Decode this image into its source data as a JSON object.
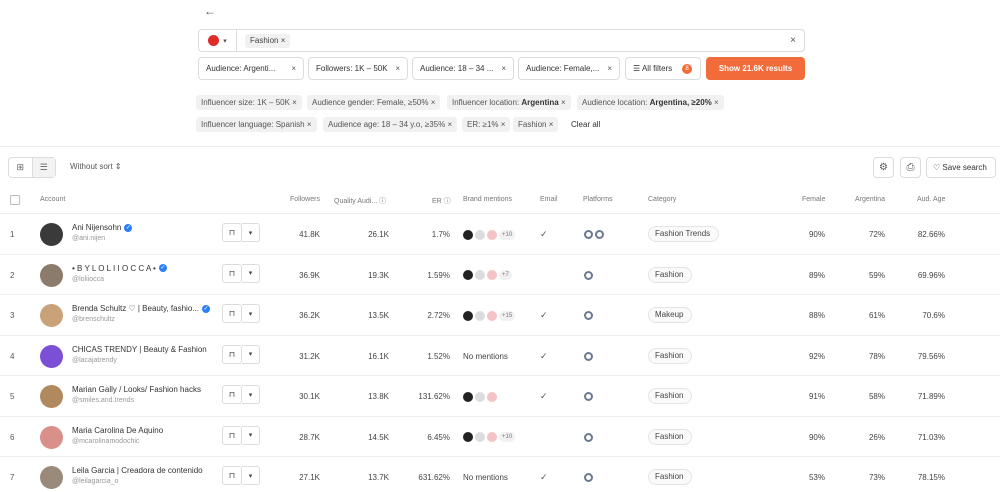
{
  "search": {
    "back_icon": "arrow-left-icon",
    "platform": "pinterest",
    "keyword_chip": "Fashion",
    "clear_symbol": "×"
  },
  "filters": [
    {
      "label": "Audience: Argenti..."
    },
    {
      "label": "Followers: 1K – 50K"
    },
    {
      "label": "Audience: 18 – 34 ..."
    },
    {
      "label": "Audience: Female,..."
    }
  ],
  "all_filters": {
    "label": "All filters",
    "count": "8"
  },
  "show_results": {
    "label": "Show 21.6K results"
  },
  "applied_chips": [
    {
      "prefix": "Influencer size: 1K – 50K",
      "bold": ""
    },
    {
      "prefix": "Audience gender: Female, ≥50%",
      "bold": ""
    },
    {
      "prefix": "Influencer location: ",
      "bold": "Argentina"
    },
    {
      "prefix": "Audience location: ",
      "bold": "Argentina, ≥20%"
    },
    {
      "prefix": "Influencer language: Spanish",
      "bold": ""
    },
    {
      "prefix": "Audience age: 18 – 34 y.o, ≥35%",
      "bold": ""
    },
    {
      "prefix": "ER: ≥1%",
      "bold": ""
    },
    {
      "prefix": "Fashion",
      "bold": ""
    }
  ],
  "clear_all": "Clear all",
  "toolbar": {
    "sort_label": "Without sort",
    "save_search_label": "Save search"
  },
  "table": {
    "headers": {
      "account": "Account",
      "followers": "Followers",
      "quality": "Quality Audi...",
      "er": "ER",
      "brand_mentions": "Brand mentions",
      "email": "Email",
      "platforms": "Platforms",
      "category": "Category",
      "female": "Female",
      "argentina": "Argentina",
      "aud_age": "Aud. Age"
    },
    "rows": [
      {
        "num": "1",
        "name": "Ani Nijensohn",
        "verified": true,
        "handle": "@ani.nijen",
        "followers": "41.8K",
        "quality": "26.1K",
        "er": "1.7%",
        "brands": "logos",
        "brands_more": "+10",
        "email": true,
        "platforms": 2,
        "category": "Fashion Trends",
        "female": "90%",
        "argentina": "72%",
        "age": "82.66%",
        "avatar_color": "#3a3a3a"
      },
      {
        "num": "2",
        "name": "• B Y L O L I I O C C A •",
        "verified": true,
        "handle": "@loliiocca",
        "followers": "36.9K",
        "quality": "19.3K",
        "er": "1.59%",
        "brands": "logos",
        "brands_more": "+7",
        "email": false,
        "platforms": 1,
        "category": "Fashion",
        "female": "89%",
        "argentina": "59%",
        "age": "69.96%",
        "avatar_color": "#8a7b6a"
      },
      {
        "num": "3",
        "name": "Brenda Schultz ♡ | Beauty, fashio...",
        "verified": true,
        "handle": "@brenschultz",
        "followers": "36.2K",
        "quality": "13.5K",
        "er": "2.72%",
        "brands": "logos",
        "brands_more": "+15",
        "email": true,
        "platforms": 1,
        "category": "Makeup",
        "female": "88%",
        "argentina": "61%",
        "age": "70.6%",
        "avatar_color": "#c9a27a"
      },
      {
        "num": "4",
        "name": "CHICAS TRENDY | Beauty & Fashion",
        "verified": false,
        "handle": "@lacajatrendy",
        "followers": "31.2K",
        "quality": "16.1K",
        "er": "1.52%",
        "brands": "No mentions",
        "brands_more": "",
        "email": true,
        "platforms": 1,
        "category": "Fashion",
        "female": "92%",
        "argentina": "78%",
        "age": "79.56%",
        "avatar_color": "#7b4fd6"
      },
      {
        "num": "5",
        "name": "Marian Gally / Looks/ Fashion hacks",
        "verified": false,
        "handle": "@smiles.and.trends",
        "followers": "30.1K",
        "quality": "13.8K",
        "er": "131.62%",
        "brands": "logos",
        "brands_more": "",
        "email": true,
        "platforms": 1,
        "category": "Fashion",
        "female": "91%",
        "argentina": "58%",
        "age": "71.89%",
        "avatar_color": "#b08a5e"
      },
      {
        "num": "6",
        "name": "Maria Carolina De Aquino",
        "verified": false,
        "handle": "@mcarolinamodochic",
        "followers": "28.7K",
        "quality": "14.5K",
        "er": "6.45%",
        "brands": "logos",
        "brands_more": "+10",
        "email": false,
        "platforms": 1,
        "category": "Fashion",
        "female": "90%",
        "argentina": "26%",
        "age": "71.03%",
        "avatar_color": "#d98f8a"
      },
      {
        "num": "7",
        "name": "Leila Garcia | Creadora de contenido",
        "verified": false,
        "handle": "@leilagarcia_o",
        "followers": "27.1K",
        "quality": "13.7K",
        "er": "631.62%",
        "brands": "No mentions",
        "brands_more": "",
        "email": true,
        "platforms": 1,
        "category": "Fashion",
        "female": "53%",
        "argentina": "73%",
        "age": "78.15%",
        "avatar_color": "#9a8a7c"
      }
    ]
  },
  "colors": {
    "accent": "#f26b3a",
    "verified": "#2d7ff9",
    "pinterest": "#e02b2b"
  }
}
